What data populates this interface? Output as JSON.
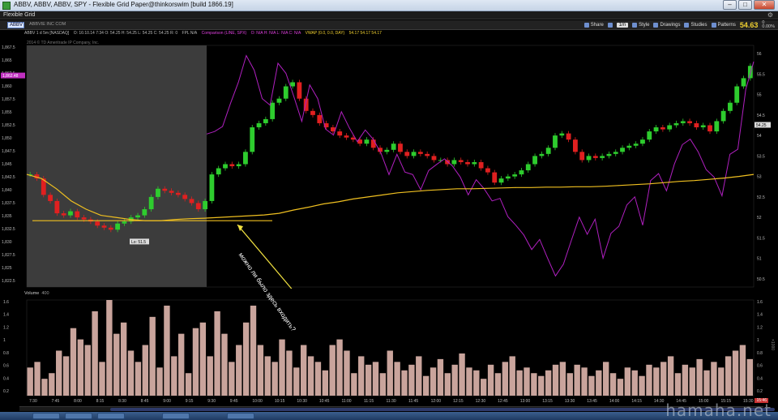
{
  "window": {
    "title": "ABBV, ABBV, ABBV, SPY - Flexible Grid Paper@thinkorswim [build 1866.19]",
    "minimize_label": "–",
    "maximize_label": "□",
    "close_label": "✕"
  },
  "menu": {
    "label": "Flexible Grid",
    "gear": "⚙"
  },
  "toolbar": {
    "symbol": "ABBV",
    "company": "ABBVIE INC COM",
    "share_label": "Share",
    "period_label": "1m",
    "style_label": "Style",
    "drawings_label": "Drawings",
    "studies_label": "Studies",
    "patterns_label": "Patterns",
    "last_price": "54.63",
    "net_change": "0",
    "net_change_pct": "0.00%"
  },
  "info_line": {
    "chart_id": "ABBV 1 d 5m [NASDAQ]",
    "ohlc": "O: 16:10.14 7:34  O: 54.25  H: 54.25  L: 54.25  C: 54.25  R: 0",
    "fpl": "FPL N/A",
    "comparison": "Comparison (LINE, SPX)",
    "comparison_values": "O: N/A  H: N/A  L: N/A  C: N/A",
    "vwap": "VWAP (0.0, 0.0, DAY)",
    "vwap_values": "54.17  54.17  54.17"
  },
  "copyright": "2014 © TD Ameritrade IP Company, Inc.",
  "low_label": "Lo: 51.5",
  "annotation": "можно ли было здесь входить?",
  "volume_header": {
    "label": "Volume",
    "value": "400"
  },
  "time_chip": "15:46",
  "watermark": "hamaha.net",
  "colors": {
    "bull": "#2ecc2e",
    "bear": "#e02020",
    "comparison": "#b020c0",
    "vwap": "#f0c020",
    "volume": "#c9a49c",
    "premarket_shade": "#3c3c3c"
  },
  "chart_data": {
    "type": "line",
    "left_axis_labels": [
      "1,867.5",
      "1,865",
      "1,862.5",
      "1,860",
      "1,857.5",
      "1,855",
      "1,852.5",
      "1,850",
      "1,847.5",
      "1,845",
      "1,842.5",
      "1,840",
      "1,837.5",
      "1,835",
      "1,832.5",
      "1,830",
      "1,827.5",
      "1,825",
      "1,822.5"
    ],
    "left_axis_highlight": "1,862.48",
    "right_axis_labels": [
      "56",
      "55.5",
      "55",
      "54.5",
      "54",
      "53.5",
      "53",
      "52.5",
      "52",
      "51.5",
      "51",
      "50.5"
    ],
    "right_axis_highlight": "54.25",
    "time_labels": [
      "7:30",
      "7:45",
      "8:00",
      "8:15",
      "8:30",
      "8:45",
      "9:00",
      "9:15",
      "9:30",
      "9:45",
      "10:00",
      "10:15",
      "10:30",
      "10:45",
      "11:00",
      "11:15",
      "11:30",
      "11:45",
      "12:00",
      "12:15",
      "12:30",
      "12:45",
      "13:00",
      "13:15",
      "13:30",
      "13:45",
      "14:00",
      "14:15",
      "14:30",
      "14:45",
      "15:00",
      "15:15",
      "15:30"
    ],
    "volume_axis_labels": [
      "1.6",
      "1.4",
      "1.2",
      "1",
      "0.8",
      "0.6",
      "0.4",
      "0.2"
    ],
    "volume_axis_unit": "×1000",
    "ylim_price": [
      50.3,
      56.2
    ],
    "series": [
      {
        "name": "ABBV",
        "kind": "candles",
        "close": [
          53.05,
          52.95,
          52.55,
          52.4,
          52.1,
          52.05,
          52.15,
          52.0,
          51.95,
          51.9,
          51.8,
          51.75,
          51.7,
          51.85,
          51.9,
          52.0,
          52.05,
          52.2,
          52.5,
          52.7,
          52.65,
          52.6,
          52.55,
          52.45,
          52.35,
          52.2,
          52.4,
          53.05,
          53.2,
          53.3,
          53.25,
          53.3,
          53.6,
          54.2,
          54.3,
          54.4,
          54.8,
          54.9,
          55.2,
          55.3,
          54.9,
          54.6,
          54.5,
          54.3,
          54.2,
          54.1,
          54.0,
          53.95,
          53.9,
          53.8,
          53.9,
          53.7,
          53.6,
          53.65,
          53.8,
          53.6,
          53.5,
          53.6,
          53.55,
          53.5,
          53.4,
          53.4,
          53.3,
          53.4,
          53.35,
          53.3,
          53.35,
          53.2,
          53.1,
          52.85,
          52.95,
          53.0,
          53.05,
          53.15,
          53.3,
          53.5,
          53.55,
          53.7,
          54.0,
          54.05,
          53.9,
          53.6,
          53.4,
          53.5,
          53.45,
          53.5,
          53.55,
          53.6,
          53.7,
          53.75,
          53.8,
          53.9,
          54.1,
          54.2,
          54.15,
          54.25,
          54.3,
          54.35,
          54.3,
          54.2,
          54.25,
          54.1,
          54.35,
          54.6,
          54.8,
          55.2,
          55.4,
          55.7
        ]
      },
      {
        "name": "SPX",
        "kind": "comparison",
        "values": [
          1851.0,
          1851.5,
          1852.5,
          1857.0,
          1861.2,
          1866.5,
          1863.6,
          1858.0,
          1856.7,
          1865.0,
          1863.0,
          1858.4,
          1853.5,
          1860.7,
          1858.0,
          1852.0,
          1850.8,
          1855.4,
          1852.2,
          1849.5,
          1851.8,
          1850.0,
          1847.2,
          1843.0,
          1847.0,
          1843.5,
          1843.0,
          1840.0,
          1843.8,
          1845.0,
          1846.1,
          1844.7,
          1842.5,
          1839.0,
          1842.0,
          1840.2,
          1837.8,
          1838.3,
          1834.7,
          1833.0,
          1831.1,
          1828.2,
          1830.2,
          1826.5,
          1823.0,
          1825.3,
          1830.0,
          1834.6,
          1831.2,
          1834.2,
          1826.5,
          1831.4,
          1832.8,
          1837.0,
          1838.6,
          1833.0,
          1841.8,
          1843.2,
          1839.8,
          1845.1,
          1848.9,
          1850.0,
          1847.5,
          1844.0,
          1842.5,
          1838.8,
          1847.0,
          1848.0,
          1859.8,
          1865.3
        ]
      },
      {
        "name": "VWAP",
        "kind": "vwap",
        "values": [
          53.05,
          52.95,
          52.7,
          52.4,
          52.2,
          52.05,
          52.0,
          51.95,
          51.92,
          51.92,
          51.95,
          51.97,
          51.98,
          52.0,
          52.02,
          52.04,
          52.06,
          52.1,
          52.18,
          52.25,
          52.33,
          52.38,
          52.45,
          52.5,
          52.55,
          52.6,
          52.63,
          52.66,
          52.68,
          52.7,
          52.7,
          52.71,
          52.72,
          52.73,
          52.73,
          52.74,
          52.74,
          52.75,
          52.75,
          52.76,
          52.78,
          52.8,
          52.82,
          52.85,
          52.88,
          52.9,
          52.93,
          52.96,
          53.0,
          53.05
        ]
      }
    ],
    "volume": [
      50,
      60,
      30,
      40,
      80,
      70,
      120,
      100,
      90,
      150,
      60,
      170,
      110,
      130,
      80,
      60,
      90,
      140,
      50,
      160,
      70,
      110,
      40,
      120,
      130,
      70,
      150,
      110,
      60,
      90,
      130,
      160,
      90,
      70,
      60,
      100,
      80,
      50,
      90,
      70,
      60,
      45,
      90,
      100,
      80,
      40,
      70,
      55,
      60,
      40,
      80,
      60,
      45,
      55,
      70,
      35,
      50,
      65,
      40,
      55,
      75,
      50,
      45,
      30,
      55,
      40,
      60,
      70,
      45,
      50,
      40,
      35,
      45,
      55,
      60,
      40,
      55,
      50,
      35,
      45,
      60,
      40,
      30,
      50,
      45,
      35,
      55,
      50,
      60,
      70,
      40,
      55,
      50,
      65,
      45,
      60,
      50,
      70,
      80,
      90,
      65
    ]
  }
}
